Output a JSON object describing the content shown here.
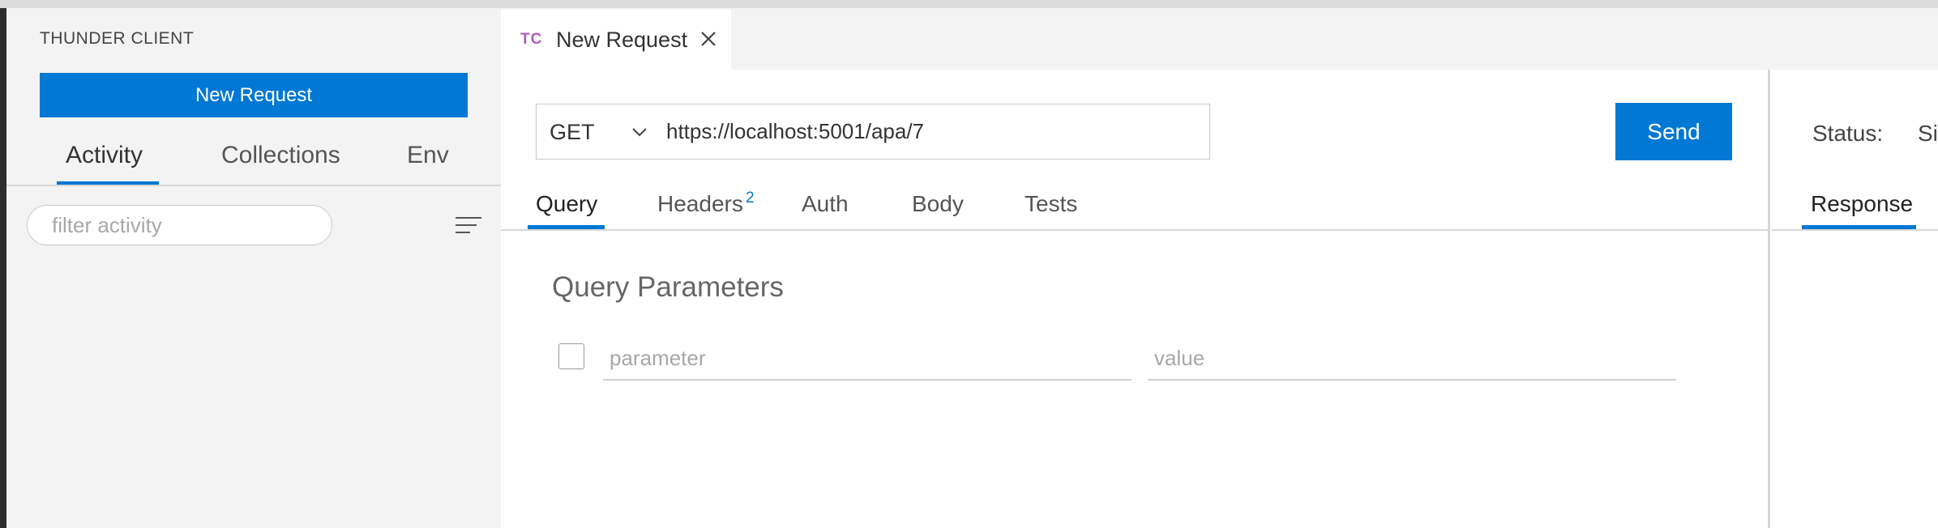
{
  "sidebar": {
    "title": "THUNDER CLIENT",
    "new_request_label": "New Request",
    "tabs": [
      {
        "label": "Activity",
        "active": true
      },
      {
        "label": "Collections",
        "active": false
      },
      {
        "label": "Env",
        "active": false
      }
    ],
    "filter_placeholder": "filter activity",
    "menu_icon": "hamburger-menu-icon"
  },
  "tabbar": {
    "tab": {
      "icon_text": "TC",
      "label": "New Request",
      "close_icon": "close-icon"
    }
  },
  "request": {
    "method": "GET",
    "url": "https://localhost:5001/apa/7",
    "send_label": "Send",
    "tabs": [
      {
        "label": "Query",
        "active": true
      },
      {
        "label": "Headers",
        "badge": "2"
      },
      {
        "label": "Auth"
      },
      {
        "label": "Body"
      },
      {
        "label": "Tests"
      }
    ],
    "query_params": {
      "title": "Query Parameters",
      "param_placeholder": "parameter",
      "value_placeholder": "value"
    }
  },
  "response": {
    "status_label": "Status:",
    "status_value": "Si",
    "tabs": [
      {
        "label": "Response",
        "active": true
      }
    ]
  },
  "colors": {
    "accent": "#0078d4",
    "tc_icon": "#b05cc0",
    "sidebar_bg": "#f3f3f3"
  }
}
